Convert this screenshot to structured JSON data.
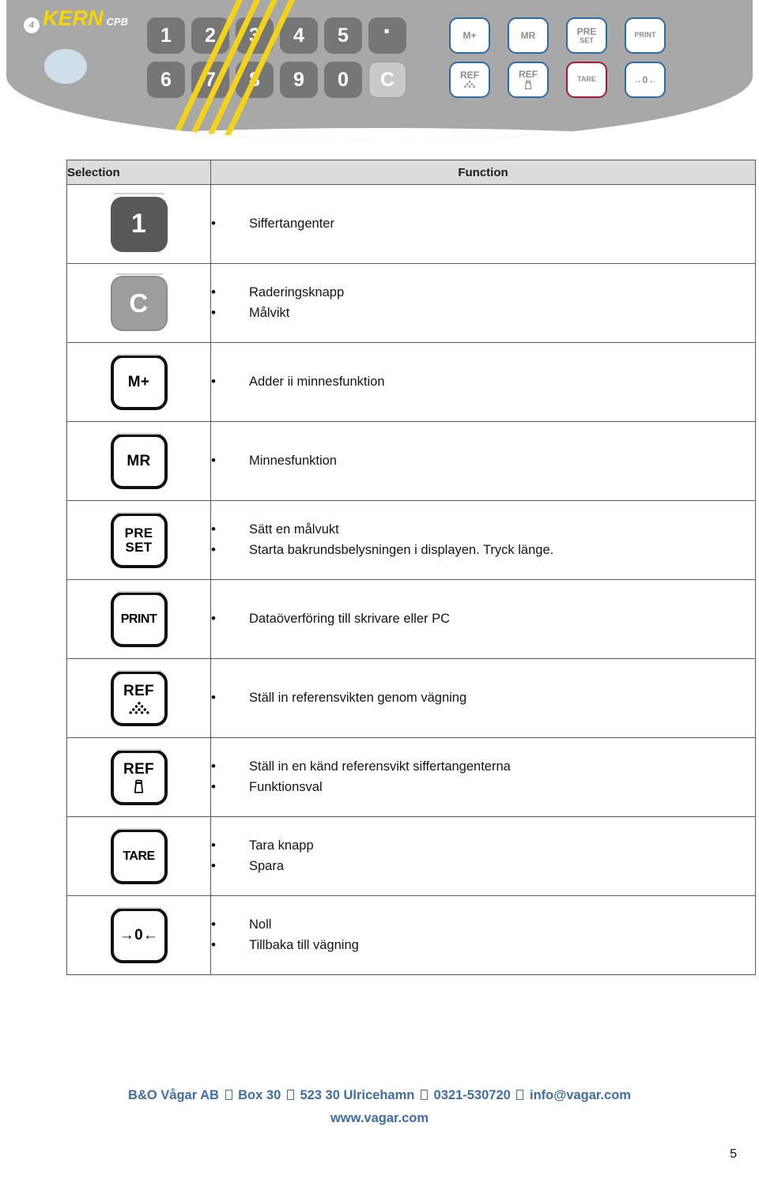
{
  "keypad": {
    "brand": "KERN",
    "brand_mark": "4",
    "model": "CPB",
    "number_keys": [
      "1",
      "2",
      "3",
      "4",
      "5",
      "·",
      "6",
      "7",
      "8",
      "9",
      "0",
      "C"
    ],
    "function_keys": [
      {
        "label": "M+",
        "sub": "",
        "color": "#2c6ba5"
      },
      {
        "label": "MR",
        "sub": "",
        "color": "#2c6ba5"
      },
      {
        "label": "PRE",
        "sub": "SET",
        "color": "#2c6ba5"
      },
      {
        "label": "PRINT",
        "sub": "",
        "color": "#2c6ba5"
      },
      {
        "label": "REF",
        "sub": "∴",
        "color": "#2c6ba5"
      },
      {
        "label": "REF",
        "sub": "⌂",
        "color": "#2c6ba5"
      },
      {
        "label": "TARE",
        "sub": "",
        "color": "#9e1b32"
      },
      {
        "label": "→0←",
        "sub": "",
        "color": "#2c6ba5"
      }
    ]
  },
  "table": {
    "headers": {
      "selection": "Selection",
      "function": "Function"
    },
    "rows": [
      {
        "key_label": "1",
        "key_style": "solid-dark",
        "key_name": "digit-1-key",
        "functions": [
          "Siffertangenter"
        ]
      },
      {
        "key_label": "C",
        "key_style": "solid-mid",
        "key_name": "clear-key",
        "functions": [
          "Raderingsknapp",
          "Målvikt"
        ]
      },
      {
        "key_label": "M+",
        "key_style": "outline",
        "key_name": "memory-add-key",
        "functions": [
          "Adder ii minnesfunktion"
        ]
      },
      {
        "key_label": "MR",
        "key_style": "outline",
        "key_name": "memory-recall-key",
        "functions": [
          "Minnesfunktion"
        ]
      },
      {
        "key_label": "PRE",
        "key_label2": "SET",
        "key_style": "outline",
        "key_name": "preset-key",
        "functions": [
          "Sätt en målvukt",
          "Starta bakrundsbelysningen i displayen. Tryck länge."
        ]
      },
      {
        "key_label": "PRINT",
        "key_style": "outline",
        "key_name": "print-key",
        "functions": [
          "Dataöverföring till skrivare eller PC"
        ]
      },
      {
        "key_label": "REF",
        "key_style": "outline",
        "key_name": "ref-weighing-key",
        "icon": "dot-pyramid-icon",
        "functions": [
          "Ställ in referensvikten genom vägning"
        ]
      },
      {
        "key_label": "REF",
        "key_style": "outline",
        "key_name": "ref-known-key",
        "icon": "calibration-weight-icon",
        "functions": [
          "Ställ in en känd referensvikt siffertangenterna",
          "Funktionsval"
        ]
      },
      {
        "key_label": "TARE",
        "key_style": "outline",
        "key_name": "tare-key",
        "functions": [
          "Tara knapp",
          "Spara"
        ]
      },
      {
        "key_label": "→0←",
        "key_style": "outline",
        "key_name": "zero-key",
        "functions": [
          "Noll",
          "Tillbaka till vägning"
        ]
      }
    ]
  },
  "footer": {
    "line1_a": "B&O Vågar AB",
    "line1_b": "Box 30",
    "line1_c": "523 30 Ulricehamn",
    "line1_d": "0321-530720",
    "line1_e": "info@vagar.com",
    "line2": "www.vagar.com",
    "color": "#3d6ea8"
  },
  "page_number": "5"
}
